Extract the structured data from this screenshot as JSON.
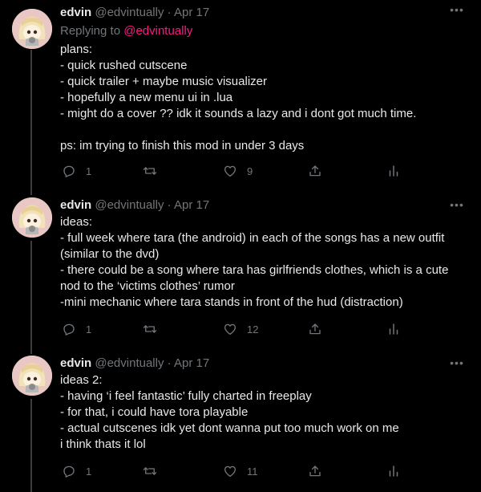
{
  "tweets": [
    {
      "name": "edvin",
      "handle": "@edvintually",
      "separator": "·",
      "date": "Apr 17",
      "replying_prefix": "Replying to",
      "replying_handle": "@edvintually",
      "lines": [
        "plans:",
        "- quick rushed cutscene",
        "- quick trailer + maybe music visualizer",
        "- hopefully a new menu ui in .lua",
        "- might do a cover ?? idk it sounds a lazy and i dont got much time.",
        "",
        "ps: im trying to finish this mod in under 3 days"
      ],
      "reply_count": "1",
      "retweet_count": "",
      "like_count": "9"
    },
    {
      "name": "edvin",
      "handle": "@edvintually",
      "separator": "·",
      "date": "Apr 17",
      "lines": [
        "ideas:",
        "- full week where tara (the android) in each of the songs has a new outfit",
        "(similar to the dvd)",
        "- there could be a song where tara has girlfriends clothes, which is a cute",
        "nod to the ‘victims clothes’ rumor",
        "-mini mechanic where tara stands in front of the hud (distraction)"
      ],
      "reply_count": "1",
      "retweet_count": "",
      "like_count": "12"
    },
    {
      "name": "edvin",
      "handle": "@edvintually",
      "separator": "·",
      "date": "Apr 17",
      "lines": [
        "ideas 2:",
        "- having ‘i feel fantastic’ fully charted in freeplay",
        "- for that, i could have tora playable",
        "- actual cutscenes idk yet dont wanna put too much work on me",
        "i think thats it lol"
      ],
      "reply_count": "1",
      "retweet_count": "",
      "like_count": "11"
    }
  ],
  "icons": {
    "more": "more-options-icon",
    "reply": "reply-icon",
    "retweet": "retweet-icon",
    "like": "like-icon",
    "share": "share-icon",
    "analytics": "analytics-icon"
  },
  "colors": {
    "background": "#000000",
    "text": "#e7e9ea",
    "muted": "#71767b",
    "mention": "#f91880",
    "thread_line": "#3a3d41"
  }
}
